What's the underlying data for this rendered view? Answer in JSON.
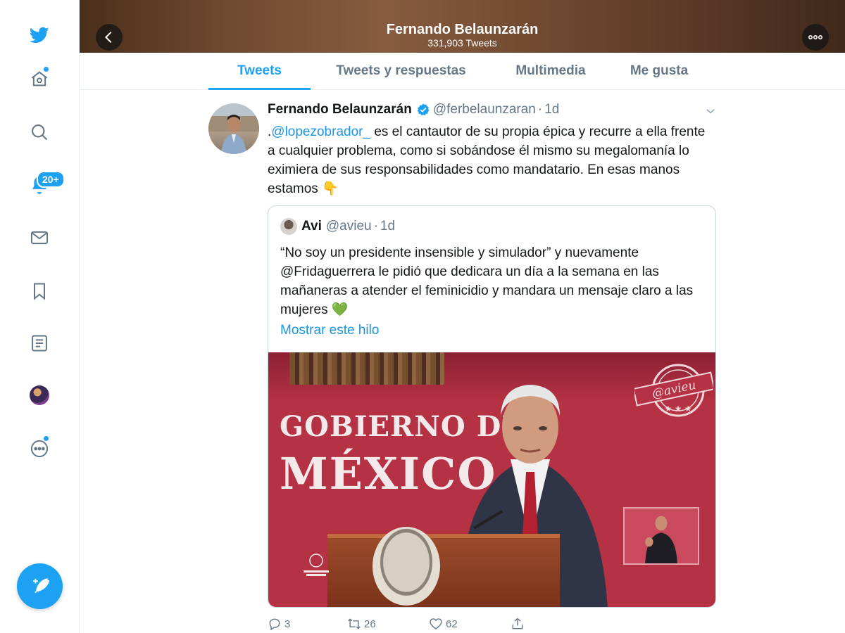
{
  "profile": {
    "name": "Fernando Belaunzarán",
    "tweet_count": "331,903 Tweets"
  },
  "sidebar": {
    "notifications_badge": "20+"
  },
  "tabs": [
    {
      "label": "Tweets",
      "active": true
    },
    {
      "label": "Tweets y respuestas",
      "active": false
    },
    {
      "label": "Multimedia",
      "active": false
    },
    {
      "label": "Me gusta",
      "active": false
    }
  ],
  "tweet": {
    "author_name": "Fernando Belaunzarán",
    "handle": "@ferbelaunzaran",
    "separator": "·",
    "time": "1d",
    "text_prefix": ".",
    "mention": "@lopezobrador_",
    "text_rest": " es el cantautor de su propia épica y recurre a ella frente a cualquier problema, como si sobándose él mismo su megalomanía lo eximiera de sus responsabilidades como mandatario. En esas manos estamos 👇",
    "quote": {
      "author_name": "Avi",
      "handle": "@avieu",
      "time": "1d",
      "text": "“No soy un presidente insensible y simulador” y nuevamente @Fridaguerrera le pidió que dedicara un día a la semana en las mañaneras a atender el feminicidio y mandara un mensaje claro a las mujeres 💚",
      "show_thread": "Mostrar este hilo",
      "media": {
        "line1": "GOBIERNO DE",
        "line2": "MÉXICO",
        "stamp_text": "@avieu"
      }
    },
    "replies": "3",
    "retweets": "26",
    "likes": "62"
  },
  "colors": {
    "accent": "#1da1f2",
    "muted": "#657786",
    "media_red": "#b53244"
  },
  "icons": [
    "twitter-logo-icon",
    "home-icon",
    "search-icon",
    "bell-icon",
    "mail-icon",
    "bookmark-icon",
    "list-icon",
    "more-circle-icon",
    "compose-icon",
    "back-arrow-icon",
    "more-horizontal-icon",
    "verified-icon",
    "chevron-down-icon",
    "reply-icon",
    "retweet-icon",
    "heart-icon",
    "share-icon"
  ]
}
